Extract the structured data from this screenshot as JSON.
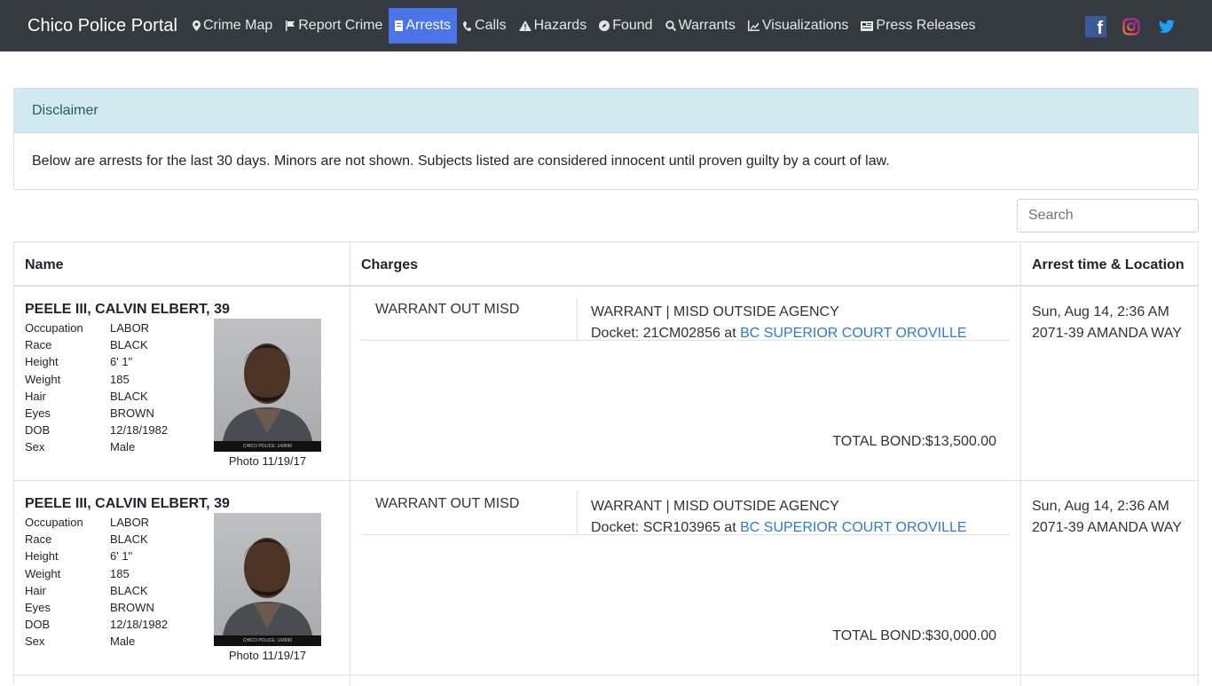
{
  "navbar": {
    "brand": "Chico Police Portal",
    "items": [
      {
        "label": "Crime Map",
        "icon": "map-marker-icon"
      },
      {
        "label": "Report Crime",
        "icon": "flag-icon"
      },
      {
        "label": "Arrests",
        "icon": "id-card-icon",
        "active": true
      },
      {
        "label": "Calls",
        "icon": "phone-icon"
      },
      {
        "label": "Hazards",
        "icon": "warning-icon"
      },
      {
        "label": "Found",
        "icon": "compass-icon"
      },
      {
        "label": "Warrants",
        "icon": "search-icon"
      },
      {
        "label": "Visualizations",
        "icon": "chart-icon"
      },
      {
        "label": "Press Releases",
        "icon": "newspaper-icon"
      }
    ],
    "social": [
      "facebook-icon",
      "instagram-icon",
      "twitter-icon"
    ],
    "colors": {
      "bg": "#343a40",
      "active": "#4a74e8"
    }
  },
  "disclaimer": {
    "title": "Disclaimer",
    "body": "Below are arrests for the last 30 days. Minors are not shown. Subjects listed are considered innocent until proven guilty by a court of law."
  },
  "search": {
    "placeholder": "Search"
  },
  "table": {
    "headers": {
      "name": "Name",
      "charges": "Charges",
      "arrest": "Arrest time & Location"
    },
    "rows": [
      {
        "name": "PEELE III, CALVIN ELBERT, 39",
        "attrs": {
          "occupation": {
            "k": "Occupation",
            "v": "LABOR"
          },
          "race": {
            "k": "Race",
            "v": "BLACK"
          },
          "height": {
            "k": "Height",
            "v": "6' 1\""
          },
          "weight": {
            "k": "Weight",
            "v": "185"
          },
          "hair": {
            "k": "Hair",
            "v": "BLACK"
          },
          "eyes": {
            "k": "Eyes",
            "v": "BROWN"
          },
          "dob": {
            "k": "DOB",
            "v": "12/18/1982"
          },
          "sex": {
            "k": "Sex",
            "v": "Male"
          }
        },
        "photo_caption": "Photo 11/19/17",
        "photo_label": "CHICO POLICE: 143690",
        "charge_type": "WARRANT OUT MISD",
        "charge_desc": "WARRANT | MISD OUTSIDE AGENCY",
        "docket_prefix": "Docket: 21CM02856 at",
        "court": "BC SUPERIOR COURT OROVILLE",
        "bond": "TOTAL BOND:$13,500.00",
        "arrest_time": "Sun, Aug 14, 2:36 AM",
        "arrest_location": "2071-39 AMANDA WAY"
      },
      {
        "name": "PEELE III, CALVIN ELBERT, 39",
        "attrs": {
          "occupation": {
            "k": "Occupation",
            "v": "LABOR"
          },
          "race": {
            "k": "Race",
            "v": "BLACK"
          },
          "height": {
            "k": "Height",
            "v": "6' 1\""
          },
          "weight": {
            "k": "Weight",
            "v": "185"
          },
          "hair": {
            "k": "Hair",
            "v": "BLACK"
          },
          "eyes": {
            "k": "Eyes",
            "v": "BROWN"
          },
          "dob": {
            "k": "DOB",
            "v": "12/18/1982"
          },
          "sex": {
            "k": "Sex",
            "v": "Male"
          }
        },
        "photo_caption": "Photo 11/19/17",
        "photo_label": "CHICO POLICE: 143690",
        "charge_type": "WARRANT OUT MISD",
        "charge_desc": "WARRANT | MISD OUTSIDE AGENCY",
        "docket_prefix": "Docket: SCR103965 at",
        "court": "BC SUPERIOR COURT OROVILLE",
        "bond": "TOTAL BOND:$30,000.00",
        "arrest_time": "Sun, Aug 14, 2:36 AM",
        "arrest_location": "2071-39 AMANDA WAY"
      }
    ]
  }
}
